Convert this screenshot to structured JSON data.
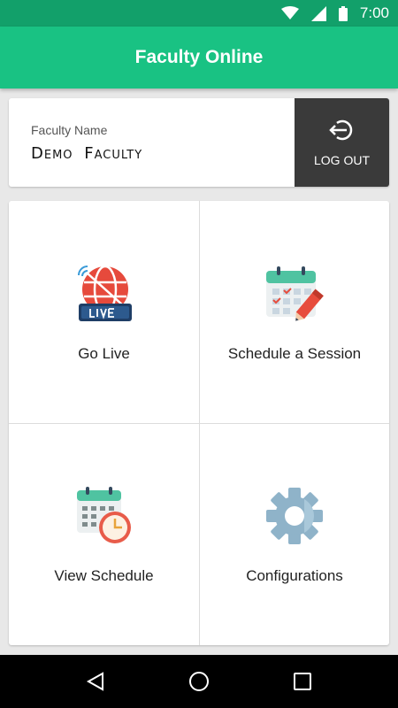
{
  "status_bar": {
    "time": "7:00",
    "icons": [
      "wifi-icon",
      "signal-icon",
      "battery-icon"
    ]
  },
  "app_bar": {
    "title": "Faculty Online"
  },
  "faculty_card": {
    "label": "Faculty Name",
    "name": "Demo Faculty",
    "logout_label": "LOG OUT",
    "logout_icon": "logout-icon"
  },
  "menu": {
    "items": [
      {
        "label": "Go Live",
        "icon": "live-broadcast-icon"
      },
      {
        "label": "Schedule a Session",
        "icon": "calendar-edit-icon"
      },
      {
        "label": "View Schedule",
        "icon": "calendar-clock-icon"
      },
      {
        "label": "Configurations",
        "icon": "gear-icon"
      }
    ]
  },
  "colors": {
    "status_bar": "#12a06a",
    "app_bar": "#19c283",
    "logout_bg": "#3a3a3a"
  }
}
